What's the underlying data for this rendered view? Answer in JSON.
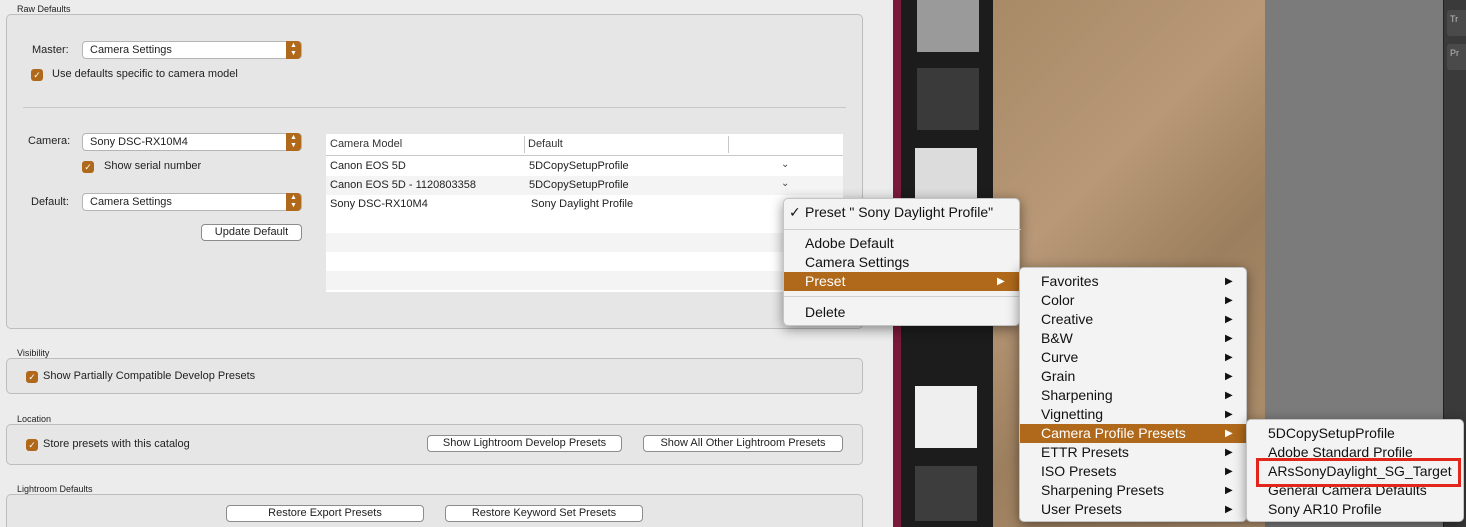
{
  "raw_defaults": {
    "title": "Raw Defaults",
    "master_label": "Master:",
    "master_value": "Camera Settings",
    "use_defaults_label": "Use defaults specific to camera model",
    "camera_label": "Camera:",
    "camera_value": "Sony DSC-RX10M4",
    "serial_label": "Show serial number",
    "default_label": "Default:",
    "default_value": "Camera Settings",
    "update_button": "Update Default",
    "table": {
      "headers": [
        "Camera Model",
        "Default"
      ],
      "rows": [
        {
          "model": "Canon EOS 5D",
          "default": "5DCopySetupProfile"
        },
        {
          "model": "Canon EOS 5D - 1120803358",
          "default": "5DCopySetupProfile"
        },
        {
          "model": "Sony DSC-RX10M4",
          "default": "Sony Daylight Profile"
        }
      ]
    }
  },
  "visibility": {
    "title": "Visibility",
    "checkbox_label": "Show Partially Compatible Develop Presets"
  },
  "location": {
    "title": "Location",
    "checkbox_label": "Store presets with this catalog",
    "btn_show_develop": "Show Lightroom Develop Presets",
    "btn_show_other": "Show All Other Lightroom Presets"
  },
  "lightroom_defaults": {
    "title": "Lightroom Defaults",
    "btn_restore_export": "Restore Export Presets",
    "btn_restore_keyword": "Restore Keyword Set Presets"
  },
  "menu1": {
    "checked_item": "Preset \" Sony Daylight Profile\"",
    "items": [
      "Adobe Default",
      "Camera Settings",
      "Preset"
    ],
    "delete": "Delete"
  },
  "menu2": {
    "items": [
      "Favorites",
      "Color",
      "Creative",
      "B&W",
      "Curve",
      "Grain",
      "Sharpening",
      "Vignetting",
      "Camera Profile Presets",
      "ETTR Presets",
      "ISO Presets",
      "Sharpening Presets",
      "User Presets"
    ]
  },
  "menu3": {
    "items": [
      "5DCopySetupProfile",
      "Adobe Standard Profile",
      "ARsSonyDaylight_SG_Target",
      "General Camera Defaults",
      "Sony AR10 Profile"
    ]
  },
  "right_panel": {
    "tabs": [
      "Tr",
      "Pr"
    ]
  },
  "colors": {
    "accent": "#b0691a",
    "highlight_box": "#e3261c"
  }
}
